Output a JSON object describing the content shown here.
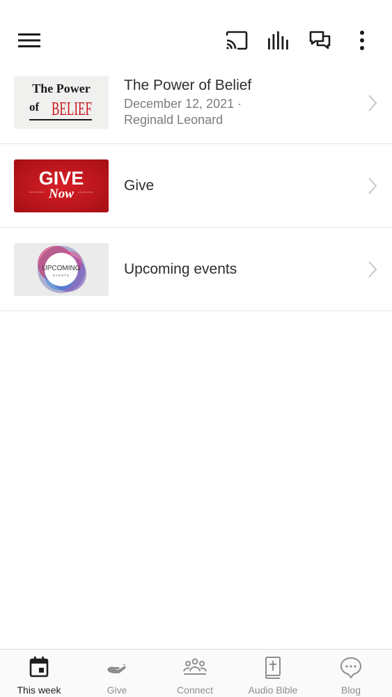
{
  "header": {
    "icons": [
      "menu-icon",
      "cast-icon",
      "audio-bars-icon",
      "chat-icon",
      "more-vert-icon"
    ]
  },
  "items": [
    {
      "title": "The Power of Belief",
      "subtitle_line1": "December 12, 2021 ·",
      "subtitle_line2": "Reginald Leonard",
      "thumb": {
        "line1": "The Power",
        "line2_prefix": "of",
        "line2_word": "BELIEF"
      }
    },
    {
      "title": "Give",
      "thumb": {
        "line1": "GIVE",
        "line2": "Now"
      }
    },
    {
      "title": "Upcoming events",
      "thumb": {
        "line1": "UPCOMING",
        "line2": "EVENTS"
      }
    }
  ],
  "tabs": [
    {
      "label": "This week",
      "icon": "calendar-icon",
      "active": true
    },
    {
      "label": "Give",
      "icon": "giving-hand-icon",
      "active": false
    },
    {
      "label": "Connect",
      "icon": "people-icon",
      "active": false
    },
    {
      "label": "Audio Bible",
      "icon": "bible-icon",
      "active": false
    },
    {
      "label": "Blog",
      "icon": "speech-bubble-icon",
      "active": false
    }
  ],
  "colors": {
    "accent_red": "#c8161d",
    "active_tab": "#1f1f1f",
    "inactive_tab": "#8e8e8e"
  }
}
